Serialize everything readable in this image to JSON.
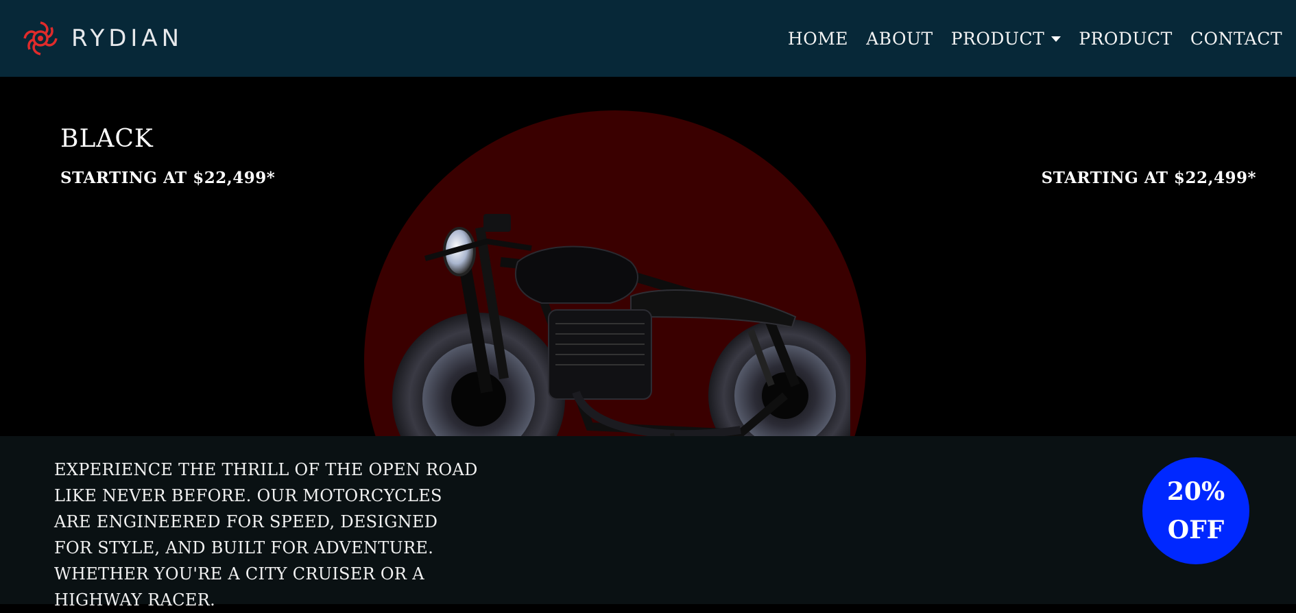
{
  "brand": {
    "name": "RYDIAN",
    "accent_color": "#e02b2b"
  },
  "nav": {
    "items": [
      {
        "label": "Home"
      },
      {
        "label": "About"
      },
      {
        "label": "Product",
        "has_dropdown": true
      },
      {
        "label": "Product"
      },
      {
        "label": "Contact"
      }
    ]
  },
  "hero": {
    "variant": "Black",
    "price_left": "STARTING AT $22,499*",
    "price_right": "STARTING AT $22,499*",
    "circle_color": "#3a0000"
  },
  "bottom": {
    "description": "Experience the thrill of the open road like never before. Our motorcycles are engineered for speed, designed for style, and built for adventure. Whether you're a city cruiser or a highway racer.",
    "badge_line1": "20%",
    "badge_line2": "OFF",
    "badge_color": "#0028ff"
  },
  "icons": {
    "logo": "rydian-logo-icon",
    "dropdown": "caret-down-icon"
  }
}
